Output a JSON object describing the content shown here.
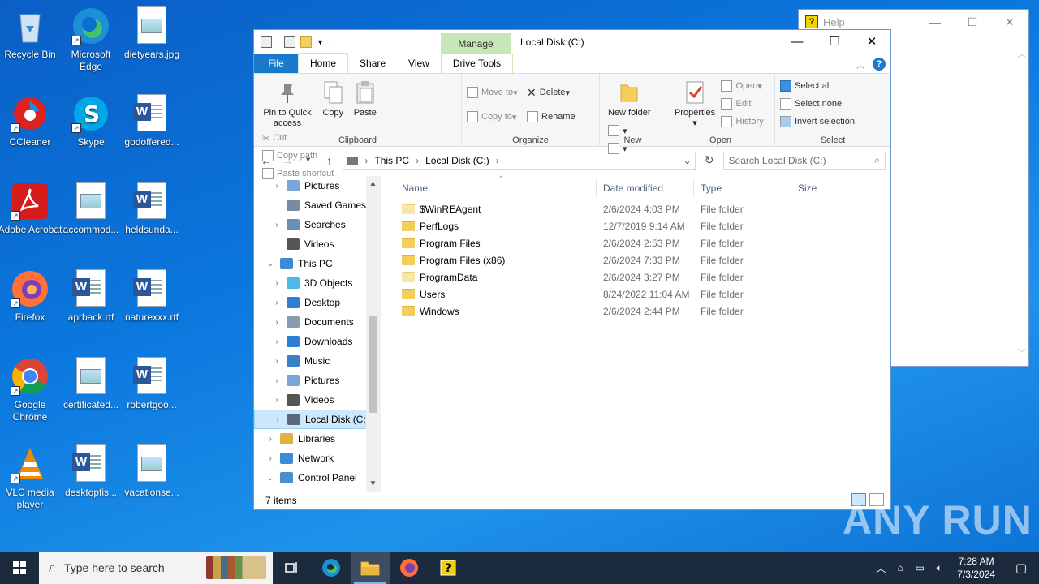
{
  "desktop": {
    "icons": [
      {
        "label": "Recycle Bin",
        "icon": "recycle-bin-icon"
      },
      {
        "label": "Microsoft Edge",
        "icon": "edge-icon"
      },
      {
        "label": "dietyears.jpg",
        "icon": "image-file-icon"
      },
      {
        "label": "CCleaner",
        "icon": "ccleaner-icon"
      },
      {
        "label": "Skype",
        "icon": "skype-icon"
      },
      {
        "label": "godoffered...",
        "icon": "word-doc-icon"
      },
      {
        "label": "Adobe Acrobat",
        "icon": "acrobat-icon"
      },
      {
        "label": "accommod...",
        "icon": "image-file-icon"
      },
      {
        "label": "heldsunda...",
        "icon": "word-doc-icon"
      },
      {
        "label": "Firefox",
        "icon": "firefox-icon"
      },
      {
        "label": "aprback.rtf",
        "icon": "word-doc-icon"
      },
      {
        "label": "naturexxx.rtf",
        "icon": "word-doc-icon"
      },
      {
        "label": "Google Chrome",
        "icon": "chrome-icon"
      },
      {
        "label": "certificated...",
        "icon": "image-file-icon"
      },
      {
        "label": "robertgoo...",
        "icon": "word-doc-icon"
      },
      {
        "label": "VLC media player",
        "icon": "vlc-icon"
      },
      {
        "label": "desktopfis...",
        "icon": "word-doc-icon"
      },
      {
        "label": "vacationse...",
        "icon": "image-file-icon"
      }
    ]
  },
  "help_window": {
    "title": "Help"
  },
  "explorer": {
    "title": "Local Disk (C:)",
    "context_tab": "Manage",
    "tabs": [
      "File",
      "Home",
      "Share",
      "View",
      "Drive Tools"
    ],
    "ribbon": {
      "clipboard": {
        "label": "Clipboard",
        "pin": "Pin to Quick access",
        "copy": "Copy",
        "paste": "Paste",
        "cut": "Cut",
        "copy_path": "Copy path",
        "paste_shortcut": "Paste shortcut"
      },
      "organize": {
        "label": "Organize",
        "move_to": "Move to",
        "copy_to": "Copy to",
        "delete": "Delete",
        "rename": "Rename"
      },
      "new": {
        "label": "New",
        "new_folder": "New folder"
      },
      "open": {
        "label": "Open",
        "properties": "Properties",
        "open": "Open",
        "edit": "Edit",
        "history": "History"
      },
      "select": {
        "label": "Select",
        "select_all": "Select all",
        "select_none": "Select none",
        "invert": "Invert selection"
      }
    },
    "address": {
      "crumbs": [
        "This PC",
        "Local Disk (C:)"
      ],
      "search_placeholder": "Search Local Disk (C:)"
    },
    "nav_items": [
      {
        "label": "Pictures",
        "indent": 1,
        "expander": ">",
        "color": "#7aa6d6"
      },
      {
        "label": "Saved Games",
        "indent": 1,
        "expander": "",
        "color": "#7a8aa0"
      },
      {
        "label": "Searches",
        "indent": 1,
        "expander": ">",
        "color": "#6b8fb5"
      },
      {
        "label": "Videos",
        "indent": 1,
        "expander": "",
        "color": "#555"
      },
      {
        "label": "This PC",
        "indent": 0,
        "expander": "v",
        "color": "#3d8ad8"
      },
      {
        "label": "3D Objects",
        "indent": 1,
        "expander": ">",
        "color": "#4fb8e8"
      },
      {
        "label": "Desktop",
        "indent": 1,
        "expander": ">",
        "color": "#2d7fd1"
      },
      {
        "label": "Documents",
        "indent": 1,
        "expander": ">",
        "color": "#8a9bb0"
      },
      {
        "label": "Downloads",
        "indent": 1,
        "expander": ">",
        "color": "#2a7fd4"
      },
      {
        "label": "Music",
        "indent": 1,
        "expander": ">",
        "color": "#3a7fc8"
      },
      {
        "label": "Pictures",
        "indent": 1,
        "expander": ">",
        "color": "#7aa6d6"
      },
      {
        "label": "Videos",
        "indent": 1,
        "expander": ">",
        "color": "#555"
      },
      {
        "label": "Local Disk (C:)",
        "indent": 1,
        "expander": ">",
        "color": "#5a6a7a",
        "selected": true
      },
      {
        "label": "Libraries",
        "indent": 0,
        "expander": ">",
        "color": "#e0b040"
      },
      {
        "label": "Network",
        "indent": 0,
        "expander": ">",
        "color": "#3d8ad8"
      },
      {
        "label": "Control Panel",
        "indent": 0,
        "expander": "v",
        "color": "#4a8fd0"
      }
    ],
    "columns": [
      "Name",
      "Date modified",
      "Type",
      "Size"
    ],
    "files": [
      {
        "name": "$WinREAgent",
        "date": "2/6/2024 4:03 PM",
        "type": "File folder",
        "light": true
      },
      {
        "name": "PerfLogs",
        "date": "12/7/2019 9:14 AM",
        "type": "File folder",
        "light": false
      },
      {
        "name": "Program Files",
        "date": "2/6/2024 2:53 PM",
        "type": "File folder",
        "light": false
      },
      {
        "name": "Program Files (x86)",
        "date": "2/6/2024 7:33 PM",
        "type": "File folder",
        "light": false
      },
      {
        "name": "ProgramData",
        "date": "2/6/2024 3:27 PM",
        "type": "File folder",
        "light": true
      },
      {
        "name": "Users",
        "date": "8/24/2022 11:04 AM",
        "type": "File folder",
        "light": false
      },
      {
        "name": "Windows",
        "date": "2/6/2024 2:44 PM",
        "type": "File folder",
        "light": false
      }
    ],
    "status": "7 items"
  },
  "watermark": "ANY RUN",
  "taskbar": {
    "search_placeholder": "Type here to search",
    "pinned": [
      "task-view-icon",
      "edge-icon",
      "file-explorer-icon",
      "firefox-icon",
      "help-icon"
    ],
    "time": "7:28 AM",
    "date": "7/3/2024"
  }
}
